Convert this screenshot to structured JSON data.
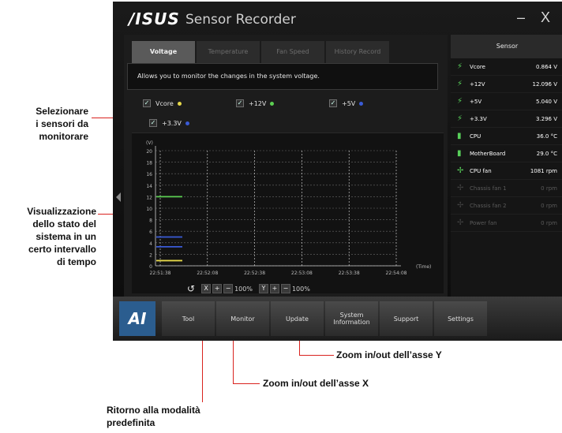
{
  "window": {
    "logo": "/ISUS",
    "title": "Sensor Recorder",
    "minimize": "–",
    "close": "X"
  },
  "tabs": [
    {
      "label": "Voltage",
      "active": true
    },
    {
      "label": "Temperature",
      "active": false
    },
    {
      "label": "Fan Speed",
      "active": false
    },
    {
      "label": "History Record",
      "active": false
    }
  ],
  "description": "Allows you to monitor the changes in the system voltage.",
  "selectors": [
    {
      "label": "Vcore",
      "color": "#e6d84a"
    },
    {
      "label": "+12V",
      "color": "#5ccf52"
    },
    {
      "label": "+5V",
      "color": "#3a5bd6"
    },
    {
      "label": "+3.3V",
      "color": "#3a5bd6"
    }
  ],
  "graph": {
    "y_unit": "(V)",
    "x_unit": "(Time)",
    "y_ticks": [
      "20",
      "18",
      "16",
      "14",
      "12",
      "10",
      "8",
      "6",
      "4",
      "2",
      "0"
    ],
    "x_ticks": [
      "22:51:38",
      "22:52:08",
      "22:52:38",
      "22:53:08",
      "22:53:38",
      "22:54:08"
    ],
    "x_zoom": "100%",
    "y_zoom": "100%",
    "x_label": "X",
    "y_label": "Y"
  },
  "chart_data": {
    "type": "line",
    "ylabel": "(V)",
    "xlabel": "(Time)",
    "ylim": [
      0,
      20
    ],
    "categories": [
      "22:51:38",
      "22:52:08",
      "22:52:38",
      "22:53:08",
      "22:53:38",
      "22:54:08"
    ],
    "series": [
      {
        "name": "+12V",
        "color": "#5ccf52",
        "values": [
          12.0
        ]
      },
      {
        "name": "+5V",
        "color": "#3a5bd6",
        "values": [
          5.0
        ]
      },
      {
        "name": "+3.3V",
        "color": "#3a5bd6",
        "values": [
          3.3
        ]
      },
      {
        "name": "Vcore",
        "color": "#e6d84a",
        "values": [
          0.9
        ]
      }
    ]
  },
  "sensor_panel": {
    "header": "Sensor",
    "rows": [
      {
        "name": "Vcore",
        "value": "0.864 V",
        "icon": "bolt-icon",
        "dim": false
      },
      {
        "name": "+12V",
        "value": "12.096 V",
        "icon": "bolt-icon",
        "dim": false
      },
      {
        "name": "+5V",
        "value": "5.040 V",
        "icon": "bolt-icon",
        "dim": false
      },
      {
        "name": "+3.3V",
        "value": "3.296 V",
        "icon": "bolt-icon",
        "dim": false
      },
      {
        "name": "CPU",
        "value": "36.0 °C",
        "icon": "thermometer-icon",
        "dim": false
      },
      {
        "name": "MotherBoard",
        "value": "29.0 °C",
        "icon": "thermometer-icon",
        "dim": false
      },
      {
        "name": "CPU fan",
        "value": "1081 rpm",
        "icon": "fan-icon",
        "dim": false
      },
      {
        "name": "Chassis fan 1",
        "value": "0 rpm",
        "icon": "fan-icon",
        "dim": true
      },
      {
        "name": "Chassis fan 2",
        "value": "0 rpm",
        "icon": "fan-icon",
        "dim": true
      },
      {
        "name": "Power fan",
        "value": "0 rpm",
        "icon": "fan-icon",
        "dim": true
      }
    ]
  },
  "dock": {
    "logo": "AI",
    "items": [
      "Tool",
      "Monitor",
      "Update",
      "System Information",
      "Support",
      "Settings"
    ]
  },
  "annotations": {
    "select_sensors": "Selezionare\ni sensori da\nmonitorare",
    "system_status": "Visualizzazione\ndello stato del\nsistema in un\ncerto intervallo\ndi tempo",
    "zoom_y": "Zoom in/out dell’asse Y",
    "zoom_x": "Zoom in/out dell’asse X",
    "default_mode": "Ritorno alla modalità\npredefinita"
  }
}
